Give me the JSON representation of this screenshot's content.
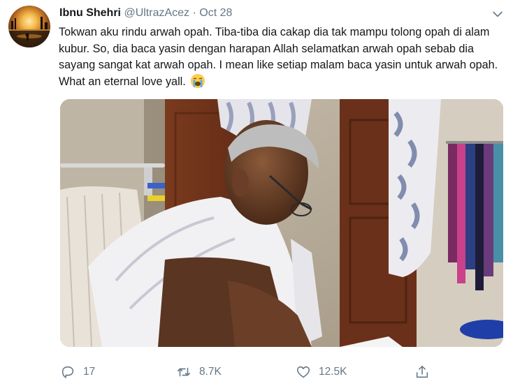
{
  "tweet": {
    "author_name": "Ibnu Shehri",
    "handle": "@UltrazAcez",
    "separator": "·",
    "date": "Oct 28",
    "text": "Tokwan aku rindu arwah opah. Tiba-tiba dia cakap dia tak mampu tolong opah di alam kubur. So, dia baca yasin dengan harapan Allah selamatkan arwah opah sebab dia sayang sangat kat arwah opah. I mean like setiap malam baca yasin untuk arwah opah. What an eternal love yall.",
    "emoji": "loudly-crying-face"
  },
  "actions": {
    "reply_count": "17",
    "retweet_count": "8.7K",
    "like_count": "12.5K"
  },
  "icons": {
    "reply": "reply-icon",
    "retweet": "retweet-icon",
    "like": "heart-icon",
    "share": "share-icon",
    "menu": "chevron-down-icon"
  },
  "colors": {
    "text": "#14171a",
    "secondary": "#657786",
    "background": "#ffffff"
  }
}
